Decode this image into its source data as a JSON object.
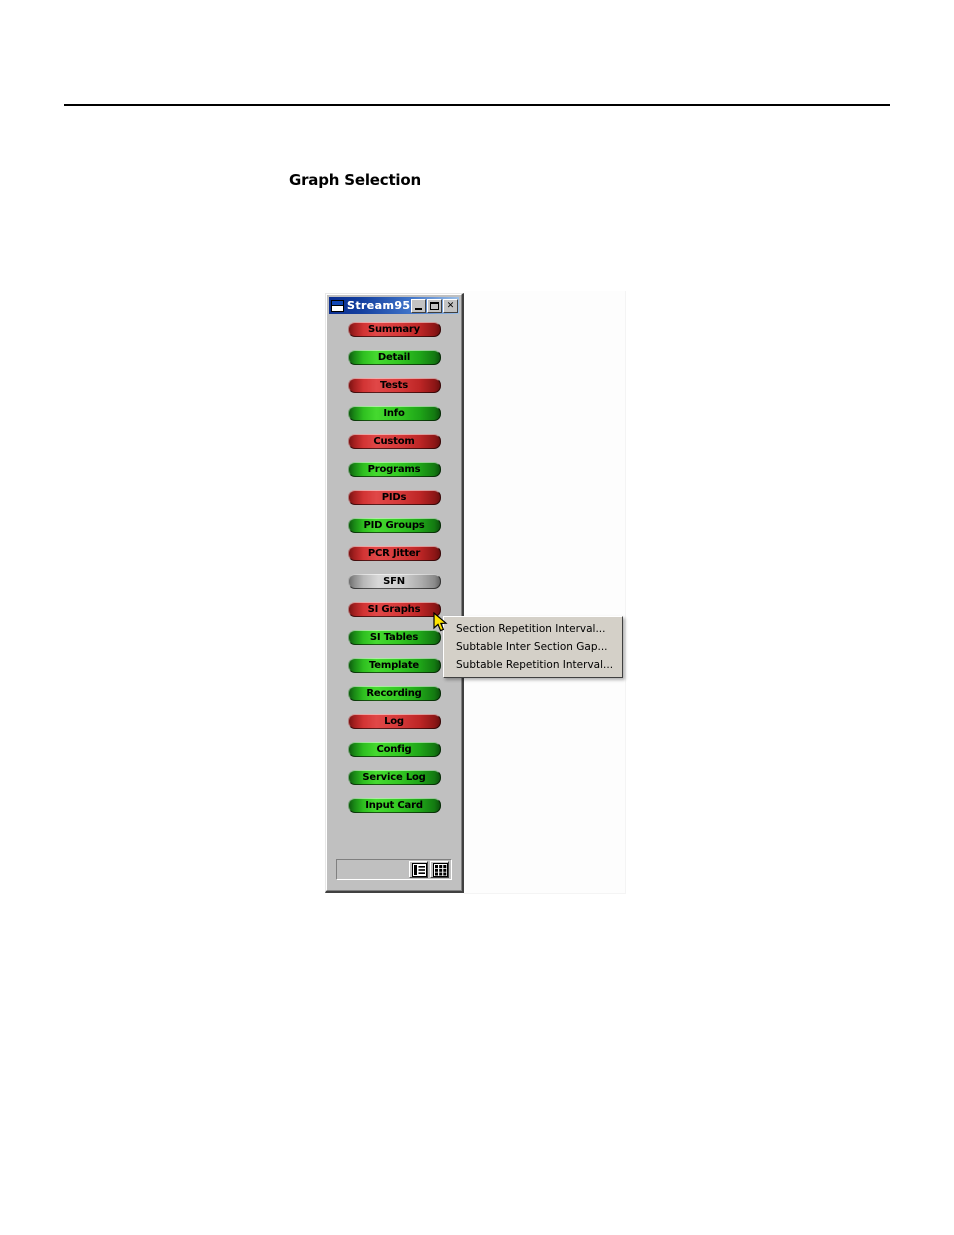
{
  "document": {
    "heading": "Graph Selection"
  },
  "window": {
    "title": "Stream95",
    "icon": "window-icon",
    "title_buttons": [
      {
        "name": "minimize",
        "glyph": "_"
      },
      {
        "name": "maximize",
        "glyph": "□"
      },
      {
        "name": "close",
        "glyph": "✕"
      }
    ],
    "buttons": [
      {
        "label": "Summary",
        "state": "red"
      },
      {
        "label": "Detail",
        "state": "green"
      },
      {
        "label": "Tests",
        "state": "red"
      },
      {
        "label": "Info",
        "state": "green"
      },
      {
        "label": "Custom",
        "state": "red"
      },
      {
        "label": "Programs",
        "state": "green"
      },
      {
        "label": "PIDs",
        "state": "red"
      },
      {
        "label": "PID Groups",
        "state": "green"
      },
      {
        "label": "PCR Jitter",
        "state": "red"
      },
      {
        "label": "SFN",
        "state": "gray"
      },
      {
        "label": "SI Graphs",
        "state": "red"
      },
      {
        "label": "SI Tables",
        "state": "green"
      },
      {
        "label": "Template",
        "state": "green"
      },
      {
        "label": "Recording",
        "state": "green"
      },
      {
        "label": "Log",
        "state": "red"
      },
      {
        "label": "Config",
        "state": "green"
      },
      {
        "label": "Service Log",
        "state": "green"
      },
      {
        "label": "Input Card",
        "state": "green"
      }
    ],
    "statusbar": {
      "view_buttons": [
        {
          "name": "list-view-icon"
        },
        {
          "name": "detail-view-icon"
        }
      ]
    }
  },
  "context_menu": {
    "items": [
      "Section Repetition Interval...",
      "Subtable Inter Section Gap...",
      "Subtable Repetition Interval..."
    ]
  },
  "colors": {
    "red_button": "#d23434",
    "green_button": "#2fc020",
    "gray_button": "#b8b8b8",
    "window_face": "#c0c0c0",
    "title_bar": "#0a2d8f",
    "menu_face": "#d4d0c8",
    "cursor": "#ffe400"
  }
}
